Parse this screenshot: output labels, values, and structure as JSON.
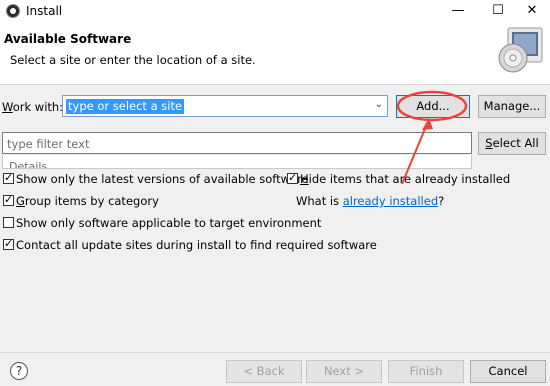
{
  "window": {
    "title": "Install",
    "minimize": "—",
    "maximize": "☐",
    "close": "✕"
  },
  "header": {
    "title": "Available Software",
    "description": "Select a site or enter the location of a site."
  },
  "work_with": {
    "label_pre": "W",
    "label_rest": "ork with:",
    "value": "type or select a site",
    "add_label": "Add...",
    "manage_label": "Manage..."
  },
  "filter": {
    "placeholder": "type filter text",
    "select_all_pre": "",
    "select_all_mn": "S",
    "select_all_rest": "elect All",
    "details_label": "Details"
  },
  "options": {
    "show_latest": {
      "label": "Show only the latest versions of available software",
      "checked": true
    },
    "group_by_category": {
      "label_mn": "G",
      "label_rest": "roup items by category",
      "checked": true
    },
    "target_env": {
      "label": "Show only software applicable to target environment",
      "checked": false
    },
    "contact_sites": {
      "label": "Contact all update sites during install to find required software",
      "checked": true
    },
    "hide_installed": {
      "label_mn": "H",
      "label_rest": "ide items that are already installed",
      "checked": true
    },
    "what_is_pre": "What is ",
    "what_is_link": "already installed",
    "what_is_post": "?"
  },
  "footer": {
    "help_icon": "?",
    "back_label": "< Back",
    "next_label": "Next >",
    "finish_label": "Finish",
    "cancel_label": "Cancel"
  },
  "annotation": {
    "color": "#e8453c"
  }
}
